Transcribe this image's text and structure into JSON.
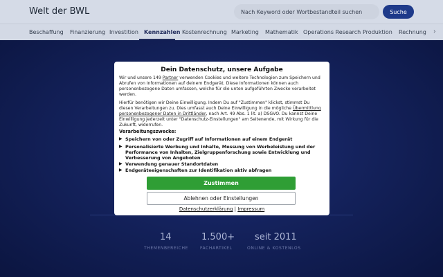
{
  "header": {
    "brand": "Welt der BWL",
    "search_placeholder": "Nach Keyword oder Wortbestandteil suchen",
    "search_button": "Suche"
  },
  "nav": {
    "items": [
      {
        "label": "Beschaffung"
      },
      {
        "label": "Finanzierung"
      },
      {
        "label": "Investition"
      },
      {
        "label": "Kennzahlen"
      },
      {
        "label": "Kostenrechnung"
      },
      {
        "label": "Marketing"
      },
      {
        "label": "Mathematik"
      },
      {
        "label": "Operations Research"
      },
      {
        "label": "Produktion"
      },
      {
        "label": "Rechnungsw"
      }
    ],
    "active": "Kennzahlen",
    "more_arrow": "›"
  },
  "stats": [
    {
      "value": "14",
      "label": "THEMENBEREICHE"
    },
    {
      "value": "1.500+",
      "label": "FACHARTIKEL"
    },
    {
      "value": "seit 2011",
      "label": "ONLINE & KOSTENLOS"
    }
  ],
  "consent": {
    "title": "Dein Datenschutz, unsere Aufgabe",
    "p1_a": "Wir und unsere 149 ",
    "p1_link": "Partner",
    "p1_b": " verwenden Cookies und weitere Technologien zum Speichern und Abrufen von Informationen auf deinem Endgerät. Diese Informationen können auch personenbezogene Daten umfassen, welche für die unten aufgeführten Zwecke verarbeitet werden.",
    "p2_a": "Hierfür benötigen wir Deine Einwilligung. Indem Du auf \"Zustimmen\" klickst, stimmst Du diesen Verarbeitungen zu. Dies umfasst auch Deine Einwilligung in die mögliche ",
    "p2_link": "Übermittlung personenbezogener Daten in Drittländer",
    "p2_b": ", nach Art. 49 Abs. 1 lit. a) DSGVO. Du kannst Deine Einwilligung jederzeit unter \"Datenschutz-Einstellungen\" am Seitenende, mit Wirkung für die Zukunft, widerrufen.",
    "purposes_heading": "Verarbeitungszwecke:",
    "purposes": [
      "Speichern von oder Zugriff auf Informationen auf einem Endgerät",
      "Personalisierte Werbung und Inhalte, Messung von Werbeleistung und der Performance von Inhalten, Zielgruppenforschung sowie Entwicklung und Verbesserung von Angeboten",
      "Verwendung genauer Standortdaten",
      "Endgeräteeigenschaften zur Identifikation aktiv abfragen"
    ],
    "bullet": "▶",
    "accept_label": "Zustimmen",
    "reject_label": "Ablehnen oder Einstellungen",
    "privacy_link": "Datenschutzerklärung",
    "separator": " | ",
    "imprint_link": "Impressum"
  },
  "colors": {
    "accept": "#2f9e35",
    "primary": "#1e3a8a",
    "hero_bg": "#14225c"
  }
}
